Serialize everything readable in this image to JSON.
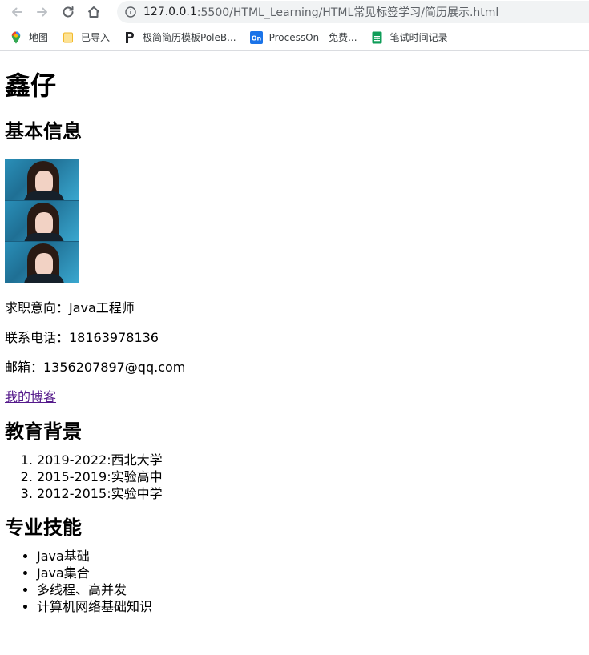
{
  "browser": {
    "url_host": "127.0.0.1",
    "url_path": ":5500/HTML_Learning/HTML常见标签学习/简历展示.html",
    "bookmarks": [
      {
        "label": "地图",
        "icon": "maps-pin-icon"
      },
      {
        "label": "已导入",
        "icon": "folder-icon"
      },
      {
        "label": "极简简历模板PoleB...",
        "icon": "polebrief-icon"
      },
      {
        "label": "ProcessOn - 免费...",
        "icon": "processon-icon"
      },
      {
        "label": "笔试时间记录",
        "icon": "sheets-icon"
      }
    ]
  },
  "resume": {
    "name": "鑫仔",
    "basic_heading": "基本信息",
    "job": "求职意向：Java工程师",
    "phone": "联系电话：18163978136",
    "email": "邮箱：1356207897@qq.com",
    "blog_link": "我的博客",
    "education_heading": "教育背景",
    "education": [
      "2019-2022:西北大学",
      "2015-2019:实验高中",
      "2012-2015:实验中学"
    ],
    "skills_heading": "专业技能",
    "skills": [
      "Java基础",
      "Java集合",
      "多线程、高并发",
      "计算机网络基础知识"
    ]
  },
  "colors": {
    "link_visited": "#551a8b",
    "omnibox_bg": "#f1f3f4"
  }
}
